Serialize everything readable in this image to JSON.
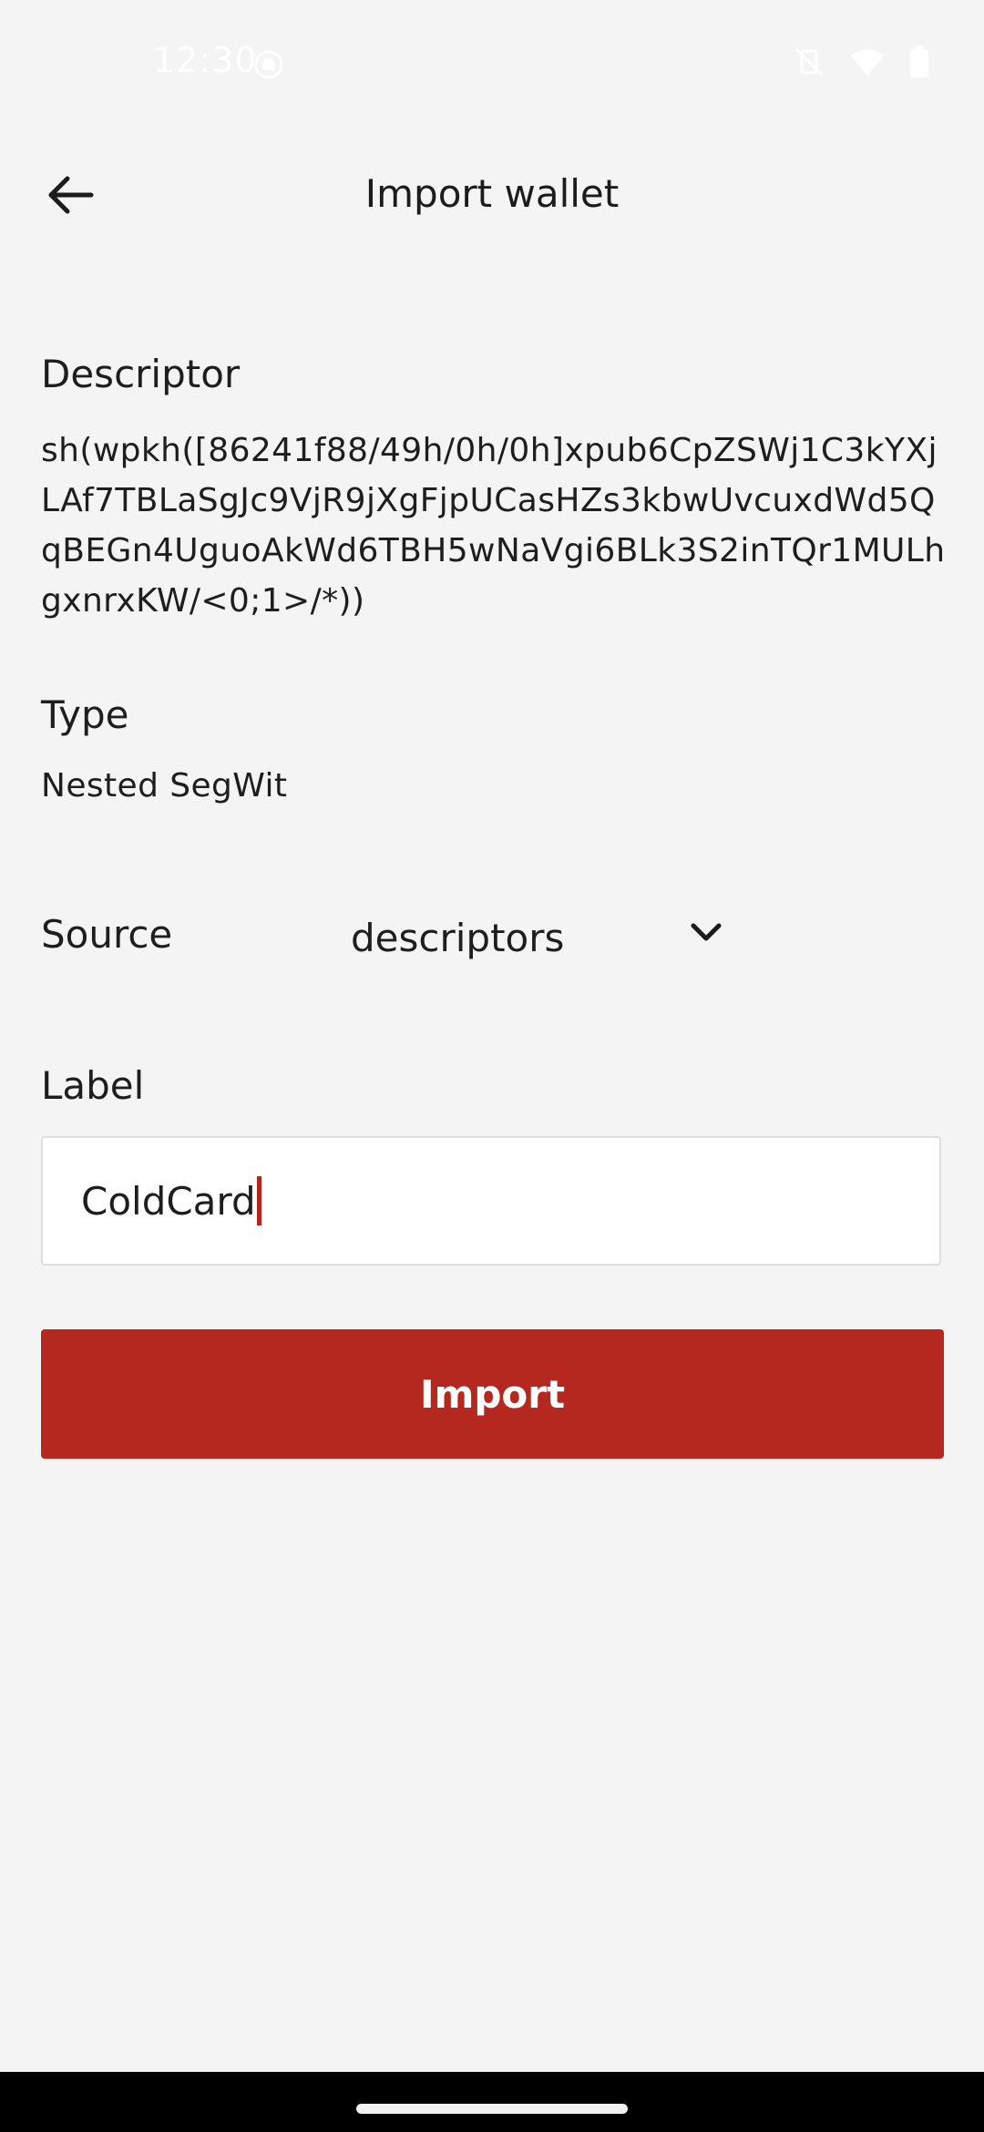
{
  "status_bar": {
    "time": "12:30",
    "icons": [
      "app-notification-icon",
      "vibrate-mute-icon",
      "wifi-icon",
      "battery-icon"
    ]
  },
  "header": {
    "back_icon": "arrow-left-icon",
    "title": "Import wallet"
  },
  "descriptor": {
    "label": "Descriptor",
    "value": "sh(wpkh([86241f88/49h/0h/0h]xpub6CpZSWj1C3kYXjLAf7TBLaSgJc9VjR9jXgFjpUCasHZs3kbwUvcuxdWd5QqBEGn4UguoAkWd6TBH5wNaVgi6BLk3S2inTQr1MULhgxnrxKW/<0;1>/*))"
  },
  "type": {
    "label": "Type",
    "value": "Nested SegWit"
  },
  "source": {
    "label": "Source",
    "selected": "descriptors",
    "icon": "chevron-down-icon"
  },
  "label_field": {
    "label": "Label",
    "value": "ColdCard"
  },
  "import_button": {
    "label": "Import"
  },
  "colors": {
    "accent": "#b52820",
    "background": "#f4f4f4",
    "caret": "#b3261e"
  }
}
